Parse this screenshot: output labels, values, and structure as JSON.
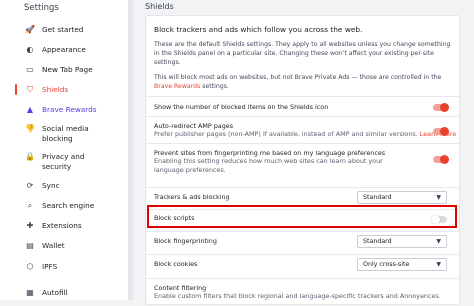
{
  "sidebar": {
    "heading": "Settings",
    "items": [
      {
        "label": "Get started",
        "icon": "rocket-icon",
        "glyph": "🚀"
      },
      {
        "label": "Appearance",
        "icon": "palette-icon",
        "glyph": "◐"
      },
      {
        "label": "New Tab Page",
        "icon": "new-tab-icon",
        "glyph": "▭"
      },
      {
        "label": "Shields",
        "icon": "shield-icon",
        "glyph": "⛉"
      },
      {
        "label": "Brave Rewards",
        "icon": "bat-icon",
        "glyph": "▲"
      },
      {
        "label": "Social media\nblocking",
        "icon": "thumbs-down-icon",
        "glyph": "👎"
      },
      {
        "label": "Privacy and\nsecurity",
        "icon": "lock-icon",
        "glyph": "🔒"
      },
      {
        "label": "Sync",
        "icon": "sync-icon",
        "glyph": "⟳"
      },
      {
        "label": "Search engine",
        "icon": "search-icon",
        "glyph": "⌕"
      },
      {
        "label": "Extensions",
        "icon": "puzzle-icon",
        "glyph": "✚"
      },
      {
        "label": "Wallet",
        "icon": "wallet-icon",
        "glyph": "▤"
      },
      {
        "label": "IPFS",
        "icon": "ipfs-icon",
        "glyph": "⬡"
      },
      {
        "label": "Autofill",
        "icon": "autofill-icon",
        "glyph": "▦"
      }
    ]
  },
  "page": {
    "title": "Shields"
  },
  "intro": {
    "title": "Block trackers and ads which follow you across the web.",
    "p1": "These are the default Shields settings. They apply to all websites unless you change something in the Shields panel on a particular site. Changing these won't affect your existing per-site settings.",
    "p2_prefix": "This will block most ads on websites, but not Brave Private Ads — those are controlled in the ",
    "p2_link": "Brave Rewards",
    "p2_suffix": " settings."
  },
  "settings": {
    "show_count": {
      "label": "Show the number of blocked items on the Shields icon",
      "on": true
    },
    "amp": {
      "label": "Auto-redirect AMP pages",
      "sub": "Prefer publisher pages (non-AMP) if available, instead of AMP and similar versions.",
      "link": "Learn more",
      "on": true
    },
    "fingerprint_lang": {
      "label": "Prevent sites from fingerprinting me based on my language preferences",
      "sub": "Enabling this setting reduces how much web sites can learn about your language preferences.",
      "on": true
    },
    "trackers": {
      "label": "Trackers & ads blocking",
      "value": "Standard"
    },
    "scripts": {
      "label": "Block scripts",
      "on": false
    },
    "fingerprinting": {
      "label": "Block fingerprinting",
      "value": "Standard"
    },
    "cookies": {
      "label": "Block cookies",
      "value": "Only cross-site"
    },
    "content_filtering": {
      "label": "Content filtering",
      "sub": "Enable custom filters that block regional and language-specific trackers and Annoyances."
    }
  },
  "colors": {
    "accent": "#e8422f",
    "highlight": "#e10000",
    "brand_purple": "#5b3be8"
  }
}
